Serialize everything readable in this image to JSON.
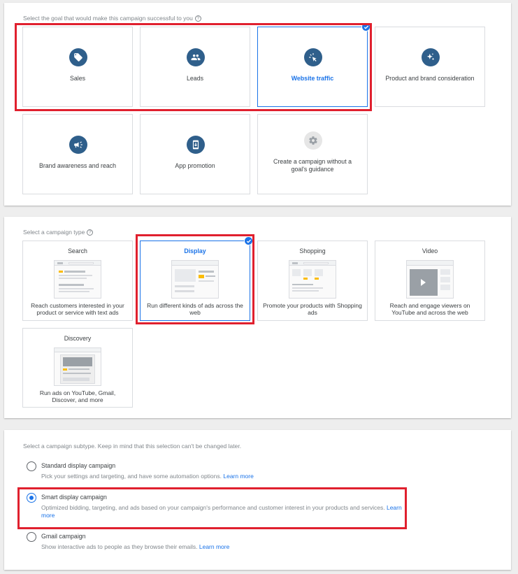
{
  "goals": {
    "prompt": "Select the goal that would make this campaign successful to you",
    "items": [
      {
        "label": "Sales",
        "icon": "sales-tag-icon"
      },
      {
        "label": "Leads",
        "icon": "leads-people-icon"
      },
      {
        "label": "Website traffic",
        "icon": "website-traffic-cursor-icon",
        "selected": true
      },
      {
        "label": "Product and brand consideration",
        "icon": "sparkle-icon"
      },
      {
        "label": "Brand awareness and reach",
        "icon": "megaphone-icon"
      },
      {
        "label": "App promotion",
        "icon": "mobile-app-icon"
      },
      {
        "label": "Create a campaign without a goal's guidance",
        "icon": "gear-icon"
      }
    ]
  },
  "campaign_type": {
    "prompt": "Select a campaign type",
    "items": [
      {
        "title": "Search",
        "desc": "Reach customers interested in your product or service with text ads"
      },
      {
        "title": "Display",
        "desc": "Run different kinds of ads across the web",
        "selected": true
      },
      {
        "title": "Shopping",
        "desc": "Promote your products with Shopping ads"
      },
      {
        "title": "Video",
        "desc": "Reach and engage viewers on YouTube and across the web"
      },
      {
        "title": "Discovery",
        "desc": "Run ads on YouTube, Gmail, Discover, and more"
      }
    ]
  },
  "subtype": {
    "prompt": "Select a campaign subtype. Keep in mind that this selection can't be changed later.",
    "options": [
      {
        "title": "Standard display campaign",
        "desc": "Pick your settings and targeting, and have some automation options.",
        "link": "Learn more",
        "selected": false
      },
      {
        "title": "Smart display campaign",
        "desc": "Optimized bidding, targeting, and ads based on your campaign's performance and customer interest in your products and services.",
        "link": "Learn more",
        "selected": true
      },
      {
        "title": "Gmail campaign",
        "desc": "Show interactive ads to people as they browse their emails.",
        "link": "Learn more",
        "selected": false
      }
    ]
  },
  "colors": {
    "accent": "#1a73e8",
    "icon_bg": "#2f5f8b",
    "highlight": "#e0202e"
  }
}
